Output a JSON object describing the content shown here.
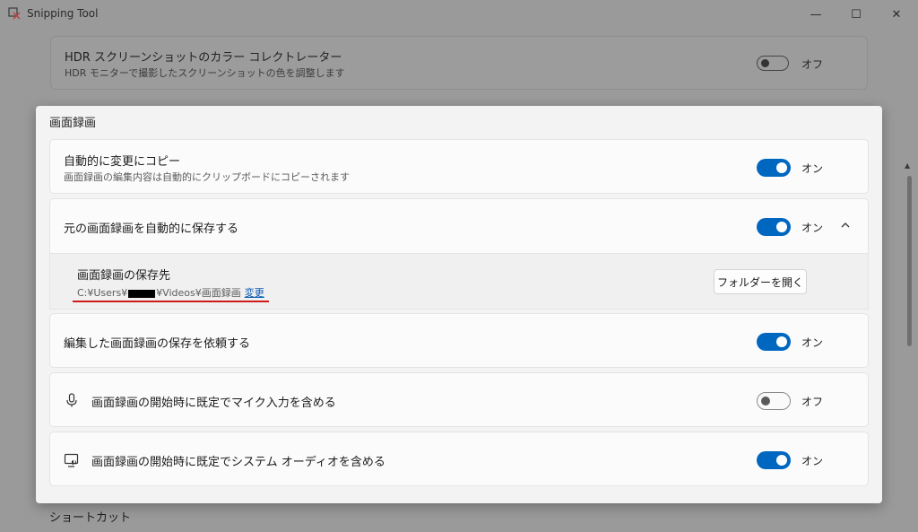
{
  "window": {
    "title": "Snipping Tool",
    "minimize": "—",
    "maximize": "☐",
    "close": "✕"
  },
  "background": {
    "hdr_card": {
      "title": "HDR スクリーンショットのカラー コレクトレーター",
      "desc": "HDR モニターで撮影したスクリーンショットの色を調整します",
      "state": "オフ"
    },
    "bottom_section_title": "ショートカット"
  },
  "panel": {
    "section_title": "画面録画",
    "rows": [
      {
        "title": "自動的に変更にコピー",
        "desc": "画面録画の編集内容は自動的にクリップボードにコピーされます",
        "toggle": "on",
        "state": "オン"
      },
      {
        "title": "元の画面録画を自動的に保存する",
        "toggle": "on",
        "state": "オン",
        "expanded": true
      },
      {
        "title": "編集した画面録画の保存を依頼する",
        "toggle": "on",
        "state": "オン"
      },
      {
        "title": "画面録画の開始時に既定でマイク入力を含める",
        "icon": "microphone-icon",
        "toggle": "off",
        "state": "オフ"
      },
      {
        "title": "画面録画の開始時に既定でシステム オーディオを含める",
        "icon": "system-audio-icon",
        "toggle": "on",
        "state": "オン"
      }
    ],
    "save_location": {
      "title": "画面録画の保存先",
      "path_prefix": "C:¥Users¥",
      "path_suffix": "¥Videos¥画面録画",
      "change_link": "変更",
      "open_folder_button": "フォルダーを開く"
    }
  },
  "colors": {
    "accent": "#0067c0",
    "annotation_underline": "#d01a1a",
    "link": "#0a5ab1"
  }
}
